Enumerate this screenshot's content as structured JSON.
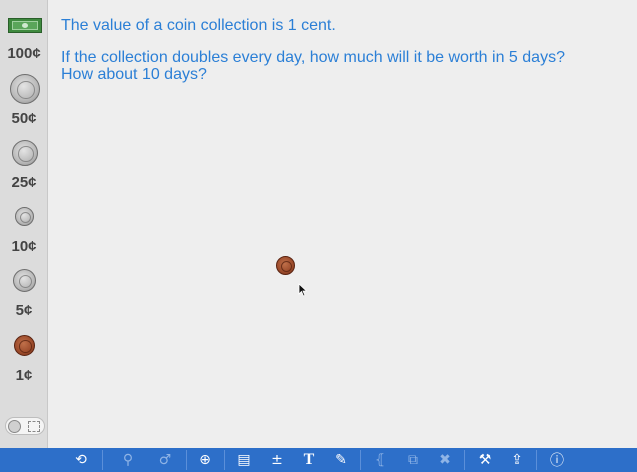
{
  "palette": {
    "items": [
      {
        "label": "100¢",
        "kind": "bill",
        "icon": "dollar-bill-icon"
      },
      {
        "label": "50¢",
        "kind": "coin",
        "icon": "half-dollar-coin-icon"
      },
      {
        "label": "25¢",
        "kind": "coin",
        "icon": "quarter-coin-icon"
      },
      {
        "label": "10¢",
        "kind": "coin",
        "icon": "dime-coin-icon"
      },
      {
        "label": "5¢",
        "kind": "coin",
        "icon": "nickel-coin-icon"
      },
      {
        "label": "1¢",
        "kind": "penny",
        "icon": "penny-coin-icon"
      }
    ],
    "toggle_icon": "view-toggle-icon"
  },
  "problem": {
    "line1": "The value of a coin collection is 1 cent.",
    "line2": "If the collection doubles every day, how much will it be worth in 5 days?",
    "line3": "How about 10 days?"
  },
  "workspace": {
    "placed_coin": "penny-coin-icon"
  },
  "toolbar": {
    "buttons": [
      {
        "name": "reset-icon",
        "glyph": "⟲",
        "enabled": true
      },
      {
        "name": "link-icon",
        "glyph": "⚲",
        "enabled": false
      },
      {
        "name": "group-icon",
        "glyph": "♂",
        "enabled": false
      },
      {
        "name": "zoom-icon",
        "glyph": "⊕",
        "enabled": true
      },
      {
        "name": "layout-icon",
        "glyph": "▤",
        "enabled": true
      },
      {
        "name": "equation-icon",
        "glyph": "±",
        "enabled": true
      },
      {
        "name": "text-icon",
        "glyph": "T",
        "enabled": true
      },
      {
        "name": "pencil-icon",
        "glyph": "✎",
        "enabled": true
      },
      {
        "name": "label-icon",
        "glyph": "⦃",
        "enabled": false
      },
      {
        "name": "duplicate-icon",
        "glyph": "⧉",
        "enabled": false
      },
      {
        "name": "trash-icon",
        "glyph": "🗑",
        "enabled": false
      },
      {
        "name": "wrench-icon",
        "glyph": "⚒",
        "enabled": true
      },
      {
        "name": "share-icon",
        "glyph": "⇪",
        "enabled": true
      },
      {
        "name": "info-icon",
        "glyph": "ⓘ",
        "enabled": true
      }
    ]
  },
  "colors": {
    "question_text": "#2b7fd6",
    "toolbar": "#2d6fc9"
  }
}
